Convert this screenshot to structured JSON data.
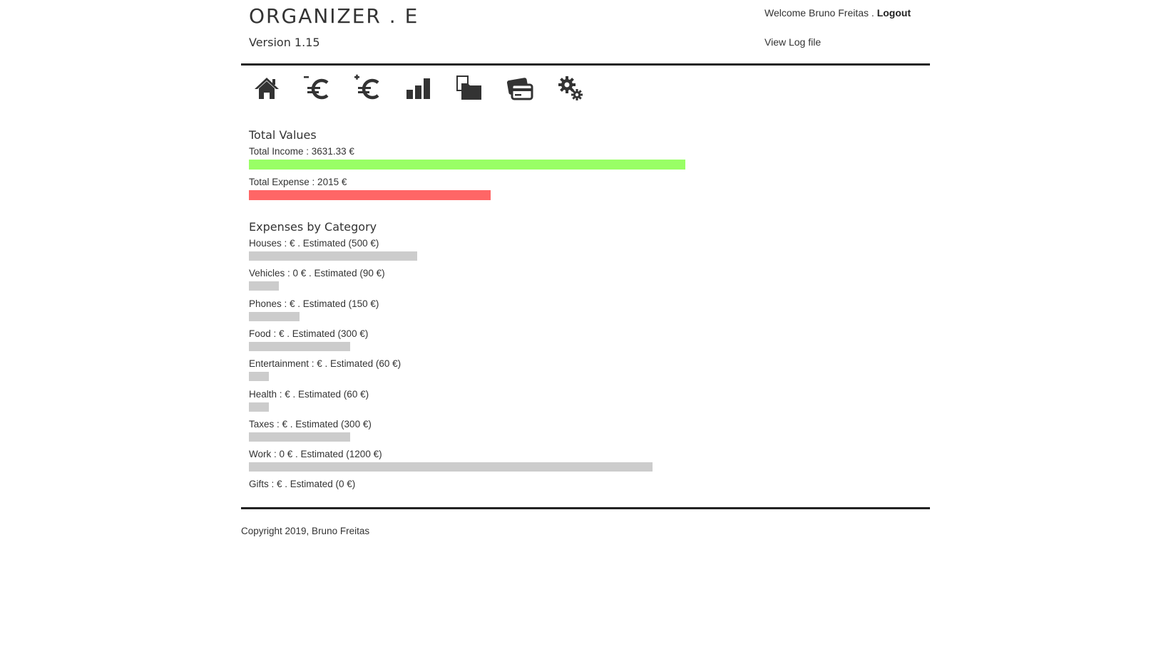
{
  "header": {
    "title": "ORGANIZER . E",
    "version": "Version 1.15",
    "welcome": "Welcome Bruno Freitas .",
    "logout_label": "Logout",
    "log_link": "View Log file"
  },
  "nav": [
    {
      "icon": "home-icon"
    },
    {
      "icon": "euro-minus-icon"
    },
    {
      "icon": "euro-plus-icon"
    },
    {
      "icon": "bar-chart-icon"
    },
    {
      "icon": "folders-icon"
    },
    {
      "icon": "credit-cards-icon"
    },
    {
      "icon": "gears-icon"
    }
  ],
  "totals": {
    "title": "Total Values",
    "income_label": "Total Income : 3631.33 €",
    "income_value": 3631.33,
    "expense_label": "Total Expense : 2015 €",
    "expense_value": 2015,
    "colors": {
      "income": "#99ff66",
      "expense": "#ff6666"
    }
  },
  "categories": {
    "title": "Expenses by Category",
    "bar_color": "#cccccc",
    "items": [
      {
        "label": "Houses : €  .  Estimated (500 €)",
        "estimated": 500
      },
      {
        "label": "Vehicles : 0 €  .  Estimated (90 €)",
        "estimated": 90
      },
      {
        "label": "Phones : €  .  Estimated (150 €)",
        "estimated": 150
      },
      {
        "label": "Food : €  .  Estimated (300 €)",
        "estimated": 300
      },
      {
        "label": "Entertainment : €  .  Estimated (60 €)",
        "estimated": 60
      },
      {
        "label": "Health : €  .  Estimated (60 €)",
        "estimated": 60
      },
      {
        "label": "Taxes : €  .  Estimated (300 €)",
        "estimated": 300
      },
      {
        "label": "Work : 0 €  .  Estimated (1200 €)",
        "estimated": 1200
      },
      {
        "label": "Gifts : €  .  Estimated (0 €)",
        "estimated": 0
      }
    ]
  },
  "footer": {
    "copyright": "Copyright 2019, Bruno Freitas"
  }
}
